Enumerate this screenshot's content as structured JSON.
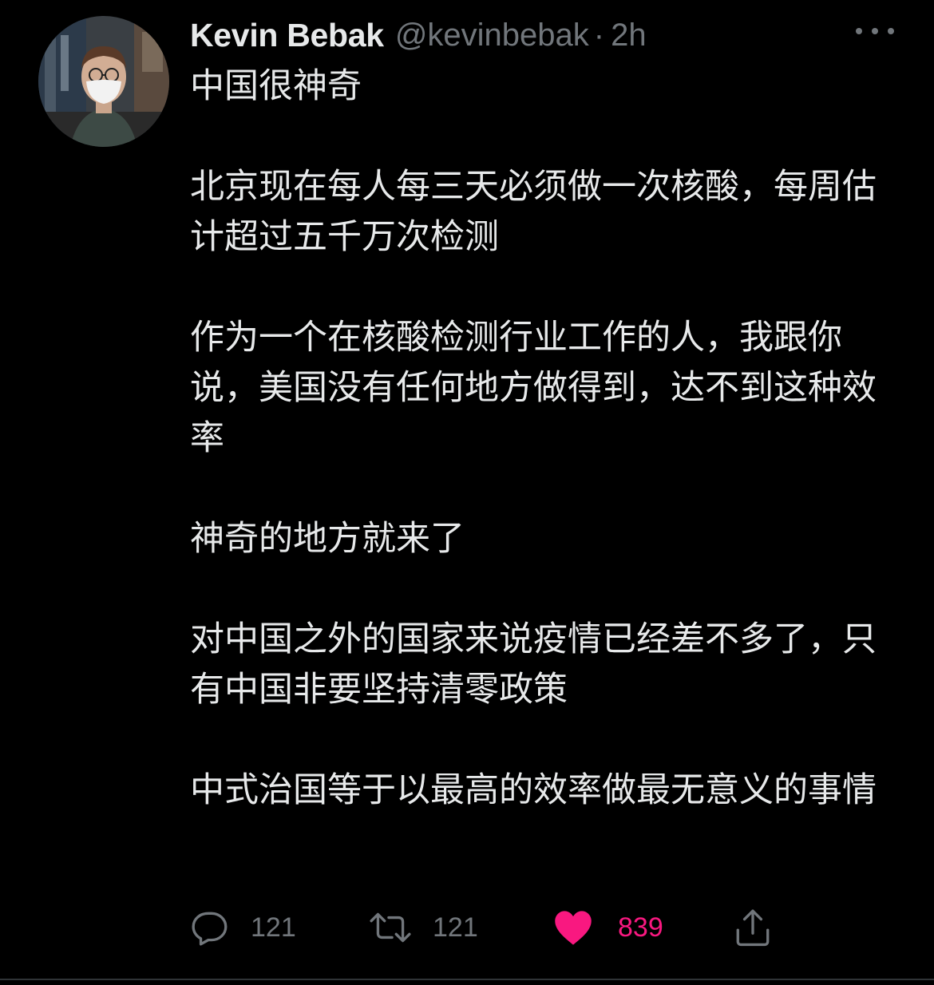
{
  "tweet": {
    "display_name": "Kevin Bebak",
    "handle": "@kevinbebak",
    "separator": "·",
    "time": "2h",
    "text": "中国很神奇\n\n北京现在每人每三天必须做一次核酸，每周估计超过五千万次检测\n\n作为一个在核酸检测行业工作的人，我跟你说，美国没有任何地方做得到，达不到这种效率\n\n神奇的地方就来了\n\n对中国之外的国家来说疫情已经差不多了，只有中国非要坚持清零政策\n\n中式治国等于以最高的效率做最无意义的事情"
  },
  "actions": {
    "reply": {
      "icon": "reply-icon",
      "count": "121"
    },
    "retweet": {
      "icon": "retweet-icon",
      "count": "121"
    },
    "like": {
      "icon": "heart-icon",
      "count": "839",
      "active": true
    },
    "share": {
      "icon": "share-icon"
    }
  },
  "colors": {
    "background": "#000000",
    "text": "#e7e9ea",
    "secondary": "#71767b",
    "like_active": "#f91880"
  }
}
